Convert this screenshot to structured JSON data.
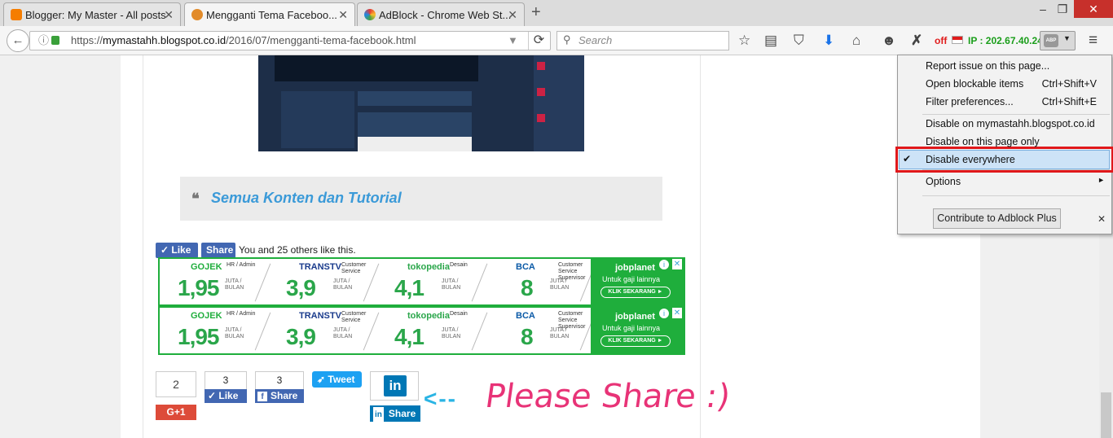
{
  "tabs": [
    {
      "title": "Blogger: My Master - All posts",
      "color": "#f57d00"
    },
    {
      "title": "Mengganti Tema Faceboo...",
      "color": "#e28b2a"
    },
    {
      "title": "AdBlock - Chrome Web St...",
      "color": "#3a8ee6"
    }
  ],
  "new_tab": "+",
  "window": {
    "min": "–",
    "max": "❐",
    "close": "✕"
  },
  "nav": {
    "url_host": "mymastahh.blogspot.co.id",
    "url_prefix": "https://",
    "url_path": "/2016/07/mengganti-tema-facebook.html",
    "search_placeholder": "Search",
    "off_label": "off",
    "ip_label": "IP : 202.67.40.24",
    "abp_label": "ABP"
  },
  "article": {
    "quote_text": "Semua Konten dan Tutorial",
    "like_label": "Like",
    "share_label": "Share",
    "like_text": "You and 25 others like this."
  },
  "ad": {
    "slots": [
      {
        "brand": "GOJEK",
        "role": "HR / Admin",
        "value": "1,95",
        "unit": "JUTA / BULAN"
      },
      {
        "brand": "TRANSTV",
        "role": "Customer Service",
        "value": "3,9",
        "unit": "JUTA / BULAN"
      },
      {
        "brand": "tokopedia",
        "role": "Desain",
        "value": "4,1",
        "unit": "JUTA / BULAN"
      },
      {
        "brand": "BCA",
        "role": "Customer Service Supervisor",
        "value": "8",
        "unit": "JUTA / BULAN"
      }
    ],
    "cta_brand": "jobplanet",
    "cta_text": "Untuk gaji lainnya",
    "cta_button": "KLIK SEKARANG ►"
  },
  "share": {
    "gplus_count": "2",
    "gplus_label": "G+1",
    "fblike_count": "3",
    "fblike_label": "Like",
    "fbshare_count": "3",
    "fbshare_label": "Share",
    "tweet_label": "Tweet",
    "linkedin_label": "Share",
    "please_text": "Please Share :)",
    "arrow_text": "<--"
  },
  "menu": {
    "items": [
      {
        "label": "Report issue on this page...",
        "shortcut": ""
      },
      {
        "label": "Open blockable items",
        "shortcut": "Ctrl+Shift+V"
      },
      {
        "label": "Filter preferences...",
        "shortcut": "Ctrl+Shift+E"
      },
      {
        "label": "Disable on mymastahh.blogspot.co.id",
        "shortcut": ""
      },
      {
        "label": "Disable on this page only",
        "shortcut": ""
      },
      {
        "label": "Disable everywhere",
        "shortcut": ""
      },
      {
        "label": "Options",
        "shortcut": "►"
      }
    ],
    "contribute_label": "Contribute to Adblock Plus",
    "check": "✔",
    "close": "✕"
  }
}
